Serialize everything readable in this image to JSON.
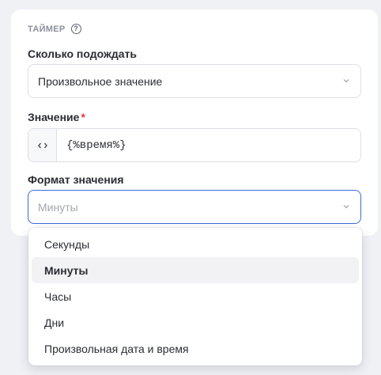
{
  "timer": {
    "section_title": "ТАЙМЕР",
    "help_symbol": "?",
    "wait": {
      "label": "Сколько подождать",
      "value": "Произвольное значение"
    },
    "value_field": {
      "label": "Значение",
      "required_mark": "*",
      "value": "{%время%}"
    },
    "format": {
      "label": "Формат значения",
      "placeholder": "Минуты",
      "options": [
        "Секунды",
        "Минуты",
        "Часы",
        "Дни",
        "Произвольная дата и время"
      ],
      "highlighted": "Минуты"
    }
  },
  "icons": {
    "help": "help-circle-icon",
    "code": "code-brackets-icon",
    "chevron": "chevron-down-icon"
  },
  "colors": {
    "accent": "#3d6bd6",
    "required": "#e03a3a",
    "muted": "#8a8f9a"
  }
}
